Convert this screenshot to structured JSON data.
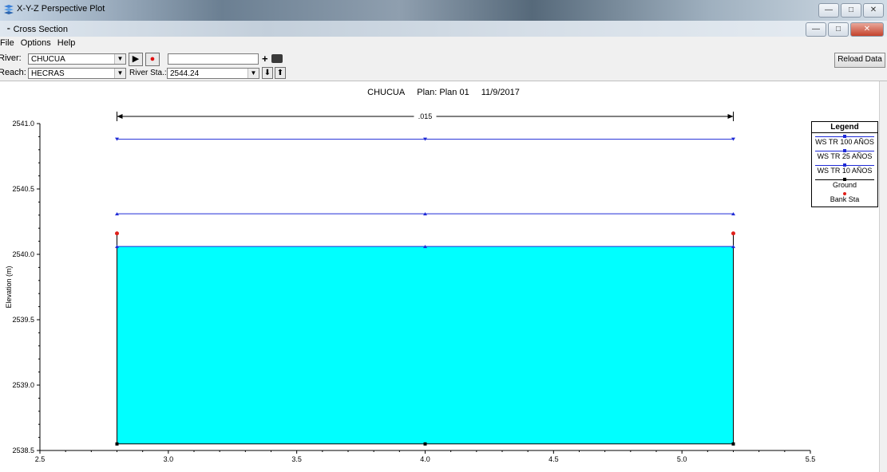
{
  "outer_window": {
    "title": "X-Y-Z Perspective Plot"
  },
  "inner_window": {
    "title": "Cross Section"
  },
  "menu": [
    "File",
    "Options",
    "Help"
  ],
  "toolbar": {
    "river_label": "River:",
    "river_value": "CHUCUA",
    "reach_label": "Reach:",
    "reach_value": "HECRAS",
    "river_sta_label": "River Sta.:",
    "river_sta_value": "2544.24",
    "reload_label": "Reload Data"
  },
  "plot_header": {
    "river": "CHUCUA",
    "plan": "Plan: Plan 01",
    "date": "11/9/2017"
  },
  "legend": {
    "title": "Legend",
    "items": [
      {
        "label": "WS TR 100 AÑOS",
        "color": "#1f2bd6"
      },
      {
        "label": "WS TR 25 AÑOS",
        "color": "#1f2bd6"
      },
      {
        "label": "WS TR 10 AÑOS",
        "color": "#1f2bd6"
      },
      {
        "label": "Ground",
        "color": "#000000"
      },
      {
        "label": "Bank Sta",
        "color": "#e0201a"
      }
    ]
  },
  "chart_data": {
    "type": "line",
    "ylabel": "Elevation (m)",
    "xlim": [
      2.5,
      5.5
    ],
    "ylim": [
      2538.5,
      2541.0
    ],
    "x_ticks": [
      "2.5",
      "3.0",
      "3.5",
      "4.0",
      "4.5",
      "5.0",
      "5.5"
    ],
    "y_ticks": [
      "2538.5",
      "2539.0",
      "2539.5",
      "2540.0",
      "2540.5",
      "2541.0"
    ],
    "manning_label": ".015",
    "manning_extent": [
      2.8,
      5.2
    ],
    "ground": {
      "x": [
        2.8,
        4.0,
        5.2
      ],
      "y": [
        2538.55,
        2538.55,
        2538.55
      ],
      "left_wall_top": 2540.16,
      "right_wall_top": 2540.16
    },
    "bank_stations": [
      {
        "x": 2.8,
        "y": 2540.16
      },
      {
        "x": 5.2,
        "y": 2540.16
      }
    ],
    "water_surfaces": [
      {
        "name": "WS TR 100 AÑOS",
        "y": 2540.88,
        "x": [
          2.8,
          4.0,
          5.2
        ]
      },
      {
        "name": "WS TR 25 AÑOS",
        "y": 2540.31,
        "x": [
          2.8,
          4.0,
          5.2
        ]
      },
      {
        "name": "WS TR 10 AÑOS",
        "y": 2540.06,
        "x": [
          2.8,
          4.0,
          5.2
        ]
      }
    ],
    "fill_color": "#00ffff",
    "ws_color": "#1f2bd6"
  }
}
